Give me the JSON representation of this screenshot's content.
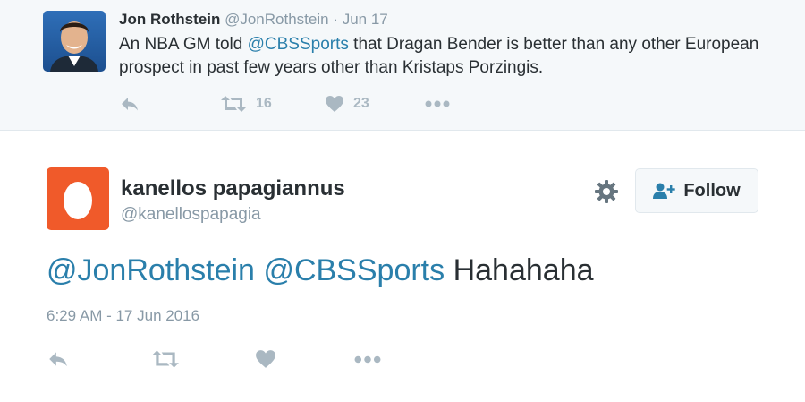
{
  "parent_tweet": {
    "author_name": "Jon Rothstein",
    "author_handle": "@JonRothstein",
    "separator": "·",
    "date": "Jun 17",
    "text_before_mention": "An NBA GM told ",
    "mention": "@CBSSports",
    "text_after_mention": " that Dragan Bender is better than any other European prospect in past few years other than Kristaps Porzingis.",
    "retweet_count": "16",
    "like_count": "23",
    "icons": [
      "reply-icon",
      "retweet-icon",
      "heart-icon",
      "more-icon"
    ]
  },
  "tweet": {
    "author_name": "kanellos papagiannus",
    "author_handle": "@kanellospapagia",
    "mention_1": "@JonRothstein",
    "mention_2": "@CBSSports",
    "body_text": "Hahahaha",
    "timestamp": "6:29 AM - 17 Jun 2016",
    "follow_label": "Follow",
    "icons": [
      "gear-icon",
      "follow-user-icon",
      "reply-icon",
      "retweet-icon",
      "heart-icon",
      "more-icon"
    ]
  },
  "colors": {
    "link": "#2a7fab",
    "muted": "#8899a6",
    "icon": "#aab8c2",
    "default_avatar_bg": "#f05a2a",
    "parent_bg": "#f5f8fa"
  }
}
